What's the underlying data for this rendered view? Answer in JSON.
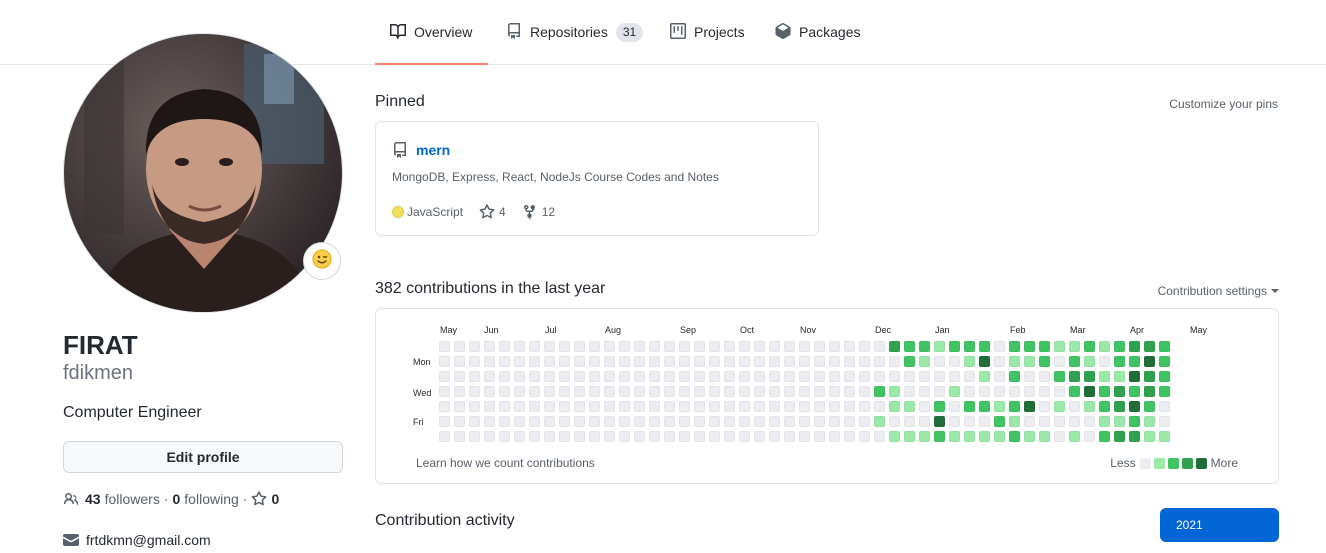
{
  "nav": {
    "tabs": [
      {
        "label": "Overview",
        "icon": "book-icon",
        "selected": true
      },
      {
        "label": "Repositories",
        "icon": "repo-icon",
        "count": "31"
      },
      {
        "label": "Projects",
        "icon": "project-icon"
      },
      {
        "label": "Packages",
        "icon": "package-icon"
      }
    ],
    "accent_color": "#f9826c"
  },
  "profile": {
    "name": "FIRAT",
    "login": "fdikmen",
    "bio": "Computer Engineer",
    "edit_label": "Edit profile",
    "followers_count": "43",
    "followers_label": "followers",
    "separator": "·",
    "following_count": "0",
    "following_label": "following",
    "stars_count": "0",
    "email": "frtdkmn@gmail.com",
    "status_emoji": "😉"
  },
  "pinned": {
    "title": "Pinned",
    "customize_label": "Customize your pins",
    "repo": {
      "name": "mern",
      "description": "MongoDB, Express, React, NodeJs Course Codes and Notes",
      "language": "JavaScript",
      "language_color": "#f1e05a",
      "stars": "4",
      "forks": "12"
    }
  },
  "contributions": {
    "title": "382 contributions in the last year",
    "settings_label": "Contribution settings",
    "months": [
      "May",
      "Jun",
      "Jul",
      "Aug",
      "Sep",
      "Oct",
      "Nov",
      "Dec",
      "Jan",
      "Feb",
      "Mar",
      "Apr",
      "May"
    ],
    "days": [
      "Mon",
      "Wed",
      "Fri"
    ],
    "learn_label": "Learn how we count contributions",
    "legend_less": "Less",
    "legend_more": "More",
    "level_colors": [
      "#ebedf0",
      "#9be9a8",
      "#40c463",
      "#30a14e",
      "#216e39"
    ],
    "weeks": [
      [
        0,
        0,
        0,
        0,
        0,
        0,
        0
      ],
      [
        0,
        0,
        0,
        0,
        0,
        0,
        0
      ],
      [
        0,
        0,
        0,
        0,
        0,
        0,
        0
      ],
      [
        0,
        0,
        0,
        0,
        0,
        0,
        0
      ],
      [
        0,
        0,
        0,
        0,
        0,
        0,
        0
      ],
      [
        0,
        0,
        0,
        0,
        0,
        0,
        0
      ],
      [
        0,
        0,
        0,
        0,
        0,
        0,
        0
      ],
      [
        0,
        0,
        0,
        0,
        0,
        0,
        0
      ],
      [
        0,
        0,
        0,
        0,
        0,
        0,
        0
      ],
      [
        0,
        0,
        0,
        0,
        0,
        0,
        0
      ],
      [
        0,
        0,
        0,
        0,
        0,
        0,
        0
      ],
      [
        0,
        0,
        0,
        0,
        0,
        0,
        0
      ],
      [
        0,
        0,
        0,
        0,
        0,
        0,
        0
      ],
      [
        0,
        0,
        0,
        0,
        0,
        0,
        0
      ],
      [
        0,
        0,
        0,
        0,
        0,
        0,
        0
      ],
      [
        0,
        0,
        0,
        0,
        0,
        0,
        0
      ],
      [
        0,
        0,
        0,
        0,
        0,
        0,
        0
      ],
      [
        0,
        0,
        0,
        0,
        0,
        0,
        0
      ],
      [
        0,
        0,
        0,
        0,
        0,
        0,
        0
      ],
      [
        0,
        0,
        0,
        0,
        0,
        0,
        0
      ],
      [
        0,
        0,
        0,
        0,
        0,
        0,
        0
      ],
      [
        0,
        0,
        0,
        0,
        0,
        0,
        0
      ],
      [
        0,
        0,
        0,
        0,
        0,
        0,
        0
      ],
      [
        0,
        0,
        0,
        0,
        0,
        0,
        0
      ],
      [
        0,
        0,
        0,
        0,
        0,
        0,
        0
      ],
      [
        0,
        0,
        0,
        0,
        0,
        0,
        0
      ],
      [
        0,
        0,
        0,
        0,
        0,
        0,
        0
      ],
      [
        0,
        0,
        0,
        0,
        0,
        0,
        0
      ],
      [
        0,
        0,
        0,
        0,
        0,
        0,
        0
      ],
      [
        0,
        0,
        0,
        2,
        0,
        1,
        0
      ],
      [
        3,
        0,
        0,
        1,
        1,
        0,
        1
      ],
      [
        2,
        2,
        0,
        0,
        1,
        0,
        1
      ],
      [
        2,
        1,
        0,
        0,
        0,
        0,
        1
      ],
      [
        1,
        0,
        0,
        0,
        2,
        4,
        2
      ],
      [
        2,
        0,
        0,
        1,
        0,
        0,
        1
      ],
      [
        2,
        1,
        0,
        0,
        2,
        0,
        1
      ],
      [
        2,
        4,
        1,
        0,
        2,
        0,
        1
      ],
      [
        0,
        0,
        0,
        0,
        1,
        2,
        1
      ],
      [
        2,
        1,
        2,
        0,
        2,
        1,
        2
      ],
      [
        2,
        1,
        0,
        0,
        4,
        0,
        1
      ],
      [
        2,
        2,
        0,
        0,
        0,
        0,
        1
      ],
      [
        1,
        0,
        2,
        0,
        1,
        0,
        0
      ],
      [
        1,
        2,
        3,
        2,
        0,
        0,
        1
      ],
      [
        2,
        1,
        3,
        4,
        1,
        0,
        0
      ],
      [
        1,
        0,
        1,
        2,
        2,
        1,
        2
      ],
      [
        2,
        2,
        1,
        3,
        3,
        1,
        3
      ],
      [
        3,
        2,
        4,
        2,
        4,
        2,
        3
      ],
      [
        3,
        4,
        3,
        3,
        2,
        1,
        1
      ],
      [
        2,
        2,
        2,
        2,
        0,
        0,
        1
      ]
    ]
  },
  "activity": {
    "title": "Contribution activity",
    "year": "2021"
  }
}
